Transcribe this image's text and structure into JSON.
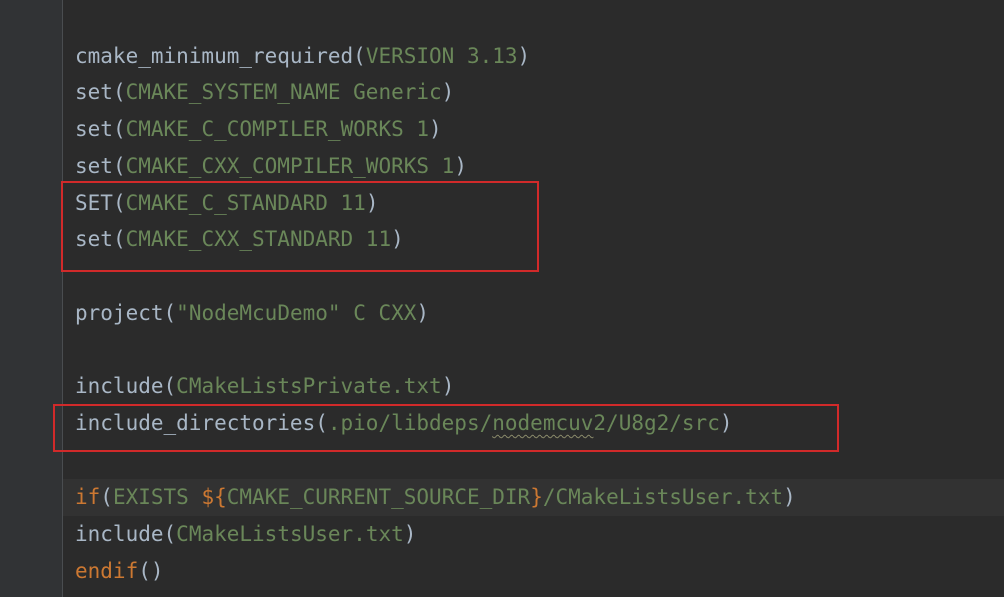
{
  "editor": {
    "language": "CMake",
    "colors": {
      "background": "#2b2b2b",
      "gutter": "#313335",
      "text": "#a9b7c6",
      "argument": "#6a8759",
      "keyword": "#cc7832",
      "highlight_box": "#d12a2a"
    },
    "lines": [
      {
        "fn": "cmake_minimum_required",
        "open": "(",
        "arg": "VERSION 3.13",
        "close": ")"
      },
      {
        "fn": "set",
        "open": "(",
        "arg": "CMAKE_SYSTEM_NAME Generic",
        "close": ")"
      },
      {
        "fn": "set",
        "open": "(",
        "arg": "CMAKE_C_COMPILER_WORKS 1",
        "close": ")"
      },
      {
        "fn": "set",
        "open": "(",
        "arg": "CMAKE_CXX_COMPILER_WORKS 1",
        "close": ")"
      },
      {
        "fn": "SET",
        "open": "(",
        "arg": "CMAKE_C_STANDARD 11",
        "close": ")"
      },
      {
        "fn": "set",
        "open": "(",
        "arg": "CMAKE_CXX_STANDARD 11",
        "close": ")"
      },
      {
        "fn": "project",
        "open": "(",
        "string": "\"NodeMcuDemo\"",
        "arg": " C CXX",
        "close": ")"
      },
      {
        "fn": "include",
        "open": "(",
        "arg": "CMakeListsPrivate.txt",
        "close": ")"
      },
      {
        "fn": "include_directories",
        "open": "(",
        "arg_a": ".pio/libdeps/",
        "arg_warn": "nodemcuv",
        "arg_b": "2/U8g2/src",
        "close": ")"
      },
      {
        "kw": "if",
        "open": "(",
        "arg_a": "EXISTS ",
        "var_open": "${",
        "arg_b": "CMAKE_CURRENT_SOURCE_DIR",
        "var_close": "}",
        "arg_c": "/CMakeListsUser.txt",
        "close": ")"
      },
      {
        "fn": "include",
        "open": "(",
        "arg": "CMakeListsUser.txt",
        "close": ")"
      },
      {
        "kw": "endif",
        "open": "(",
        "close": ")"
      }
    ]
  }
}
